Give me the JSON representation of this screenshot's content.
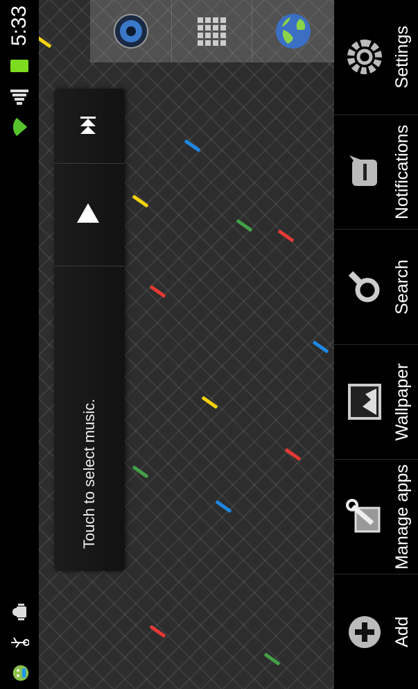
{
  "status_bar": {
    "time": "5:33",
    "left_icons": [
      "android-icon",
      "usb-icon",
      "debug-icon"
    ],
    "right_icons": [
      "wifi-icon",
      "signal-icon",
      "battery-icon"
    ]
  },
  "music_widget": {
    "text": "Touch to select music.",
    "play_icon": "play-icon",
    "next_icon": "next-icon"
  },
  "quick_launch": {
    "items": [
      {
        "name": "speaker-icon"
      },
      {
        "name": "app-grid-icon"
      },
      {
        "name": "browser-globe-icon"
      }
    ]
  },
  "menu": {
    "items": [
      {
        "label": "Add",
        "icon": "add-icon"
      },
      {
        "label": "Manage apps",
        "icon": "manage-apps-icon"
      },
      {
        "label": "Wallpaper",
        "icon": "wallpaper-icon"
      },
      {
        "label": "Search",
        "icon": "search-icon"
      },
      {
        "label": "Notifications",
        "icon": "notifications-icon"
      },
      {
        "label": "Settings",
        "icon": "settings-icon"
      }
    ]
  },
  "colors": {
    "status_bg": "#000000",
    "battery": "#7ddc1f",
    "menu_bg": "#000000",
    "confetti": [
      "#f5d20f",
      "#e53935",
      "#43a047",
      "#1e88e5"
    ]
  }
}
